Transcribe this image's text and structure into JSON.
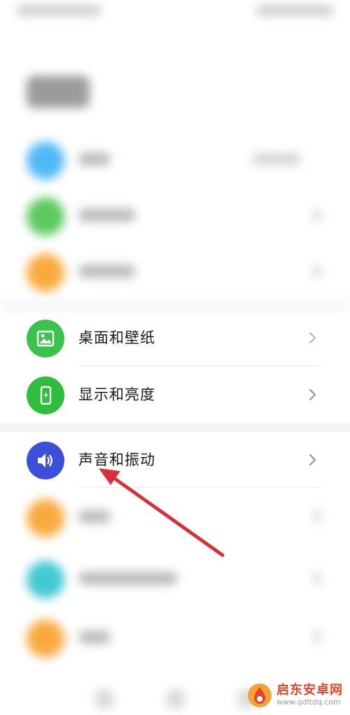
{
  "settings": {
    "items": [
      {
        "label": "桌面和壁纸",
        "icon": "image-icon",
        "icon_color": "#3cc24a"
      },
      {
        "label": "显示和亮度",
        "icon": "phone-brightness-icon",
        "icon_color": "#2fbd3d"
      },
      {
        "label": "声音和振动",
        "icon": "speaker-icon",
        "icon_color": "#3b50d6"
      }
    ]
  },
  "colors": {
    "blurred_icons": [
      "#4fb9f5",
      "#5cc95e",
      "#f9aa3f",
      "#f9aa3f",
      "#44c9d4",
      "#f9aa3f"
    ],
    "arrow": "#d8303a"
  },
  "watermark": {
    "name": "启东安卓网",
    "url": "www.qdltdq.com"
  }
}
